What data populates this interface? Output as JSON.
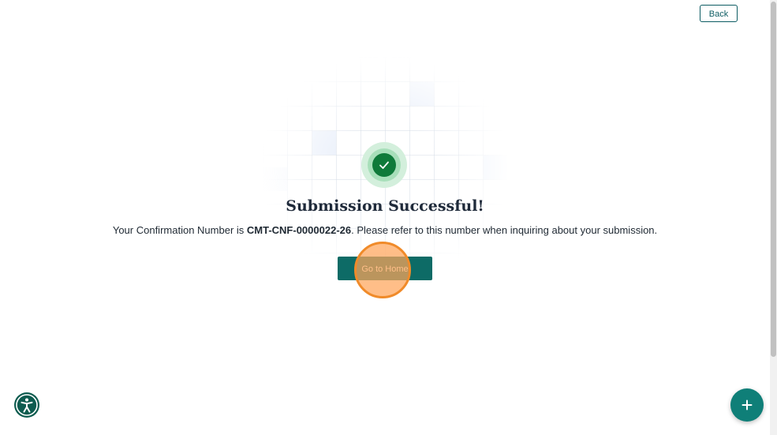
{
  "header": {
    "back_label": "Back"
  },
  "result": {
    "title": "Submission Successful!",
    "message_prefix": "Your Confirmation Number is ",
    "confirmation_number": "CMT-CNF-0000022-26",
    "message_suffix": ". Please refer to this number when inquiring about your submission.",
    "home_button_label": "Go to Home"
  },
  "icons": {
    "success": "check-icon",
    "accessibility": "accessibility-icon",
    "fab": "plus-icon"
  },
  "colors": {
    "primary": "#0d6b66",
    "success": "#0f7a3a",
    "highlight": "#f08b2a"
  }
}
